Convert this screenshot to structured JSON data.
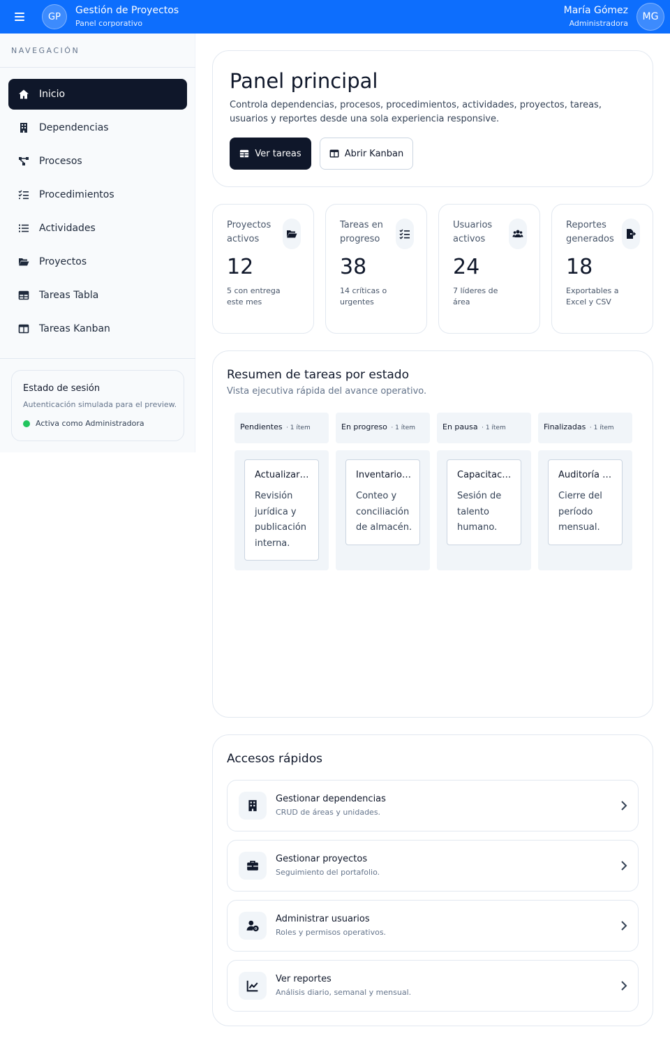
{
  "header": {
    "logo": "GP",
    "title": "Gestión de Proyectos",
    "subtitle": "Panel corporativo",
    "user_name": "María Gómez",
    "user_role": "Administradora",
    "avatar": "MG",
    "color": "#0d6efd"
  },
  "sidebar": {
    "heading": "NAVEGACIÓN",
    "items": [
      {
        "label": "Inicio",
        "icon": "home-icon",
        "active": true
      },
      {
        "label": "Dependencias",
        "icon": "building-icon"
      },
      {
        "label": "Procesos",
        "icon": "flow-icon"
      },
      {
        "label": "Procedimientos",
        "icon": "checklist-icon"
      },
      {
        "label": "Actividades",
        "icon": "list-icon"
      },
      {
        "label": "Proyectos",
        "icon": "folder-open-icon"
      },
      {
        "label": "Tareas Tabla",
        "icon": "table-icon"
      },
      {
        "label": "Tareas Kanban",
        "icon": "kanban-icon"
      }
    ],
    "session": {
      "title": "Estado de sesión",
      "subtitle": "Autenticación simulada para el preview.",
      "status": "Activa como Administradora",
      "status_color": "#22c55e"
    }
  },
  "hero": {
    "title": "Panel principal",
    "description": "Controla dependencias, procesos, procedimientos, actividades, proyectos, tareas, usuarios y reportes desde una sola experiencia responsive.",
    "primary_button": "Ver tareas",
    "secondary_button": "Abrir Kanban"
  },
  "stats": [
    {
      "label": "Proyectos activos",
      "value": "12",
      "note": "5 con entrega este mes",
      "icon": "folder-open-icon"
    },
    {
      "label": "Tareas en progreso",
      "value": "38",
      "note": "14 críticas o urgentes",
      "icon": "checklist-icon"
    },
    {
      "label": "Usuarios activos",
      "value": "24",
      "note": "7 líderes de área",
      "icon": "users-icon"
    },
    {
      "label": "Reportes generados",
      "value": "18",
      "note": "Exportables a Excel y CSV",
      "icon": "export-file-icon"
    }
  ],
  "summary": {
    "title": "Resumen de tareas por estado",
    "subtitle": "Vista ejecutiva rápida del avance operativo.",
    "columns": [
      {
        "name": "Pendientes",
        "count": "· 1 ítem",
        "task_title": "Actualizar …",
        "task_desc": "Revisión jurídica y publicación interna."
      },
      {
        "name": "En progreso",
        "count": "· 1 ítem",
        "task_title": "Inventario…",
        "task_desc": "Conteo y conciliación de almacén."
      },
      {
        "name": "En pausa",
        "count": "· 1 ítem",
        "task_title": "Capacitac…",
        "task_desc": "Sesión de talento humano."
      },
      {
        "name": "Finalizadas",
        "count": "· 1 ítem",
        "task_title": "Auditoría …",
        "task_desc": "Cierre del período mensual."
      }
    ]
  },
  "quick": {
    "title": "Accesos rápidos",
    "items": [
      {
        "title": "Gestionar dependencias",
        "subtitle": "CRUD de áreas y unidades.",
        "icon": "building-icon"
      },
      {
        "title": "Gestionar proyectos",
        "subtitle": "Seguimiento del portafolio.",
        "icon": "briefcase-icon"
      },
      {
        "title": "Administrar usuarios",
        "subtitle": "Roles y permisos operativos.",
        "icon": "user-gear-icon"
      },
      {
        "title": "Ver reportes",
        "subtitle": "Análisis diario, semanal y mensual.",
        "icon": "chart-line-icon"
      }
    ]
  }
}
